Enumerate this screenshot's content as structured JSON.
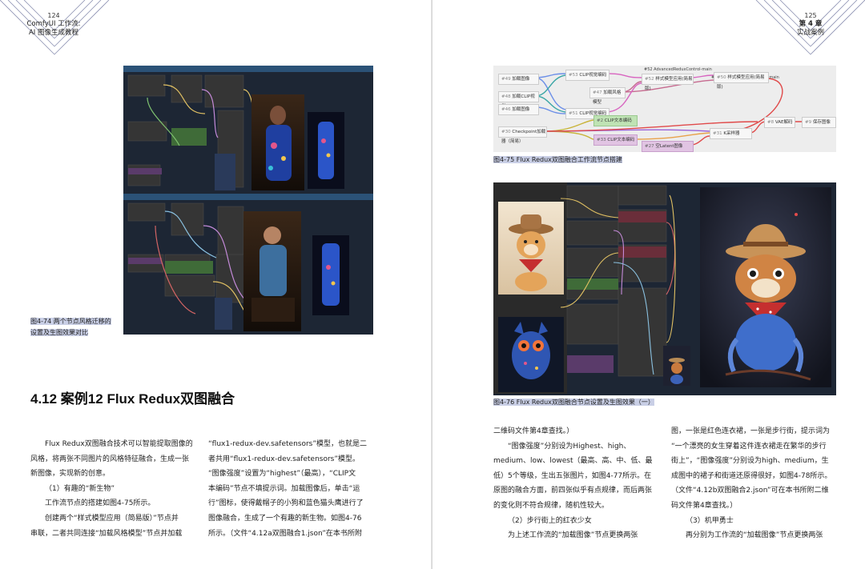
{
  "left_page": {
    "page_number": "124",
    "running_title_1": "ComfyUI 工作流:",
    "running_title_2": "AI 图像生成教程",
    "figure_caption_1": "图4-74   两个节点风格迁移的",
    "figure_caption_2": "设置及生图效果对比",
    "section_title": "4.12   案例12  Flux Redux双图融合",
    "col1": [
      "Flux Redux双图融合技术可以智能提取图像的",
      "风格，将两张不同图片的风格特征融合，生成一张",
      "新图像，实现新的创意。",
      "（1）有趣的“新生物”",
      "工作流节点的搭建如图4-75所示。",
      "创建两个“样式模型应用（简易版）”节点并",
      "串联，二者共同连接“加载风格模型”节点并加载"
    ],
    "col2": [
      "“flux1-redux-dev.safetensors”模型，也就是二",
      "者共用“flux1-redux-dev.safetensors”模型。",
      "“图像强度”设置为“highest”（最高），“CLIP文",
      "本编码”节点不填提示词。加载图像后，单击“运",
      "行”图标，使得戴帽子的小狗和蓝色猫头鹰进行了",
      "图像融合，生成了一个有趣的新生物。如图4-76",
      "所示。（文件“4.12a双图融合1.json”在本书所附"
    ]
  },
  "right_page": {
    "page_number": "125",
    "chapter": "第 4 章",
    "chapter_title": "实战案例",
    "figure75_caption": "图4-75   Flux Redux双图融合工作流节点搭建",
    "figure76_caption": "图4-76   Flux Redux双图融合节点设置及生图效果（一）",
    "workflow_nodes": [
      {
        "id": "#49",
        "label": "加载图像"
      },
      {
        "id": "#53",
        "label": "CLIP视觉编码"
      },
      {
        "id": "#52",
        "label": "样式模型应用(简易版)"
      },
      {
        "id": "#50",
        "label": "样式模型应用(简易版)"
      },
      {
        "id": "#47",
        "label": "加载风格模型"
      },
      {
        "id": "#48",
        "label": "加载CLIP视觉"
      },
      {
        "id": "#46",
        "label": "加载图像"
      },
      {
        "id": "#51",
        "label": "CLIP视觉编码"
      },
      {
        "id": "#2",
        "label": "CLIP文本编码"
      },
      {
        "id": "#30",
        "label": "Checkpoint加载器（简易）"
      },
      {
        "id": "#33",
        "label": "CLIP文本编码"
      },
      {
        "id": "#27",
        "label": "空Latent图像（SD3）"
      },
      {
        "id": "#31",
        "label": "K采样器"
      },
      {
        "id": "#8",
        "label": "VAE解码"
      },
      {
        "id": "#9",
        "label": "保存图像"
      }
    ],
    "workflow_group_titles": [
      "#52 AdvancedReduxControl-main",
      "#50 AdvancedReduxControl-main"
    ],
    "col1": [
      "二维码文件第4章查找。）",
      "“图像强度”分别设为Highest、high、",
      "medium、low、lowest（最高、高、中、低、最",
      "低）5个等级，生出五张图片，如图4-77所示。在",
      "原图的融合方面，前四张似乎有点规律，而后两张",
      "的变化则不符合规律，随机性较大。",
      "（2）步行街上的红衣少女",
      "为上述工作流的“加载图像”节点更换两张"
    ],
    "col2": [
      "图，一张是红色连衣裙，一张是步行街，提示词为",
      "“一个漂亮的女生穿着这件连衣裙走在繁华的步行",
      "街上”，“图像强度”分别设为high、medium，生",
      "成图中的裙子和街道还原得很好，如图4-78所示。",
      "（文件“4.12b双图融合2.json”可在本书所附二维",
      "码文件第4章查找。）",
      "（3）机甲勇士",
      "再分别为工作流的“加载图像”节点更换两张"
    ]
  },
  "colors": {
    "caption_highlight": "#c9cfe6",
    "node_editor_bg": "#1d2634",
    "node_bg": "#353535",
    "workflow_bg": "#ededed"
  }
}
